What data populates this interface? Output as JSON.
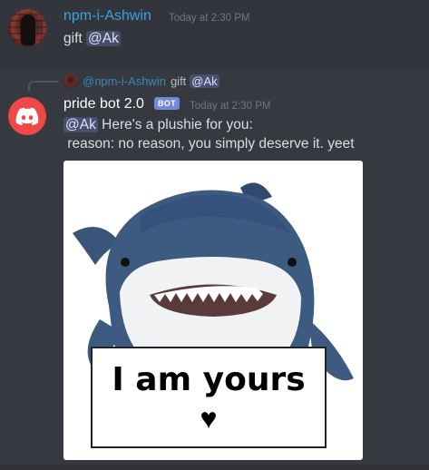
{
  "message1": {
    "username": "npm-i-Ashwin",
    "timestamp": "Today at 2:30 PM",
    "text": "gift",
    "mention": "@Ak"
  },
  "reply": {
    "username": "@npm-i-Ashwin",
    "text": "gift",
    "mention": "@Ak"
  },
  "message2": {
    "username": "pride bot 2.0",
    "bot_tag": "BOT",
    "timestamp": "Today at 2:30 PM",
    "mention": "@Ak",
    "line1": "Here's a plushie for you:",
    "line2": "reason: no reason, you simply deserve it. yeet"
  },
  "image": {
    "sign_text": "I am yours",
    "sign_heart": "♥"
  },
  "colors": {
    "background": "#36393f",
    "username_blue": "#3ba3e0",
    "bot_tag": "#7289da",
    "discord_red": "#f04747"
  }
}
